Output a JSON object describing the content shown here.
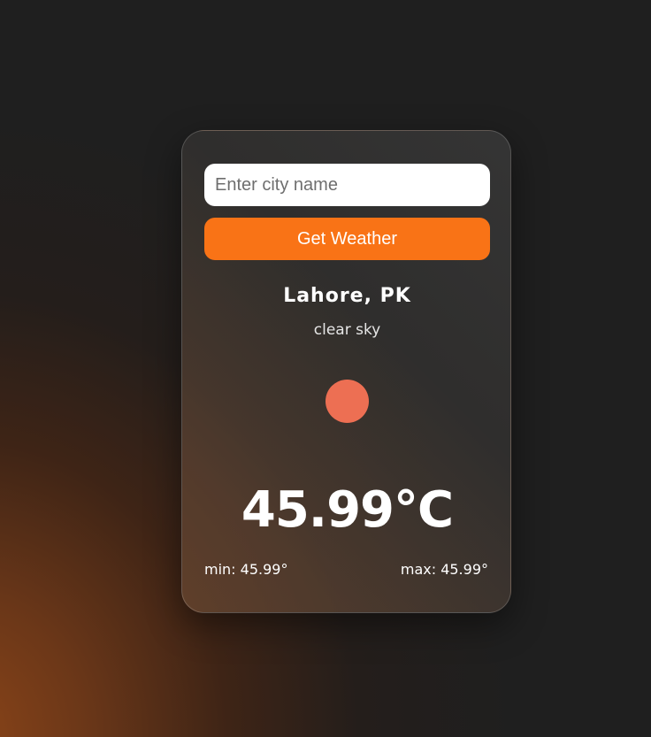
{
  "search": {
    "placeholder": "Enter city name",
    "value": ""
  },
  "button": {
    "label": "Get Weather"
  },
  "weather": {
    "city": "Lahore, PK",
    "description": "clear sky",
    "icon": "sun-icon",
    "temperature": "45.99°C",
    "min": "min: 45.99°",
    "max": "max: 45.99°"
  },
  "colors": {
    "accent": "#f97316",
    "icon": "#ed6f53",
    "background": "#1f1f1f"
  }
}
